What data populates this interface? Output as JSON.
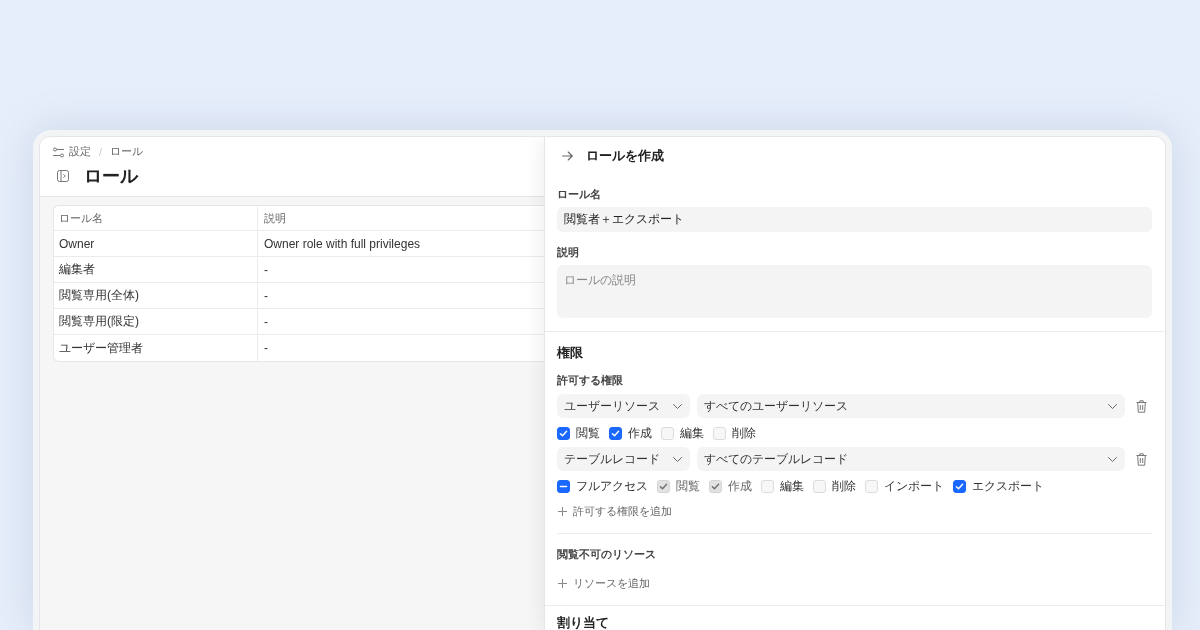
{
  "breadcrumb": {
    "items": [
      "設定",
      "ロール"
    ],
    "separator": "/"
  },
  "page_title": "ロール",
  "table": {
    "columns": [
      "ロール名",
      "説明"
    ],
    "rows": [
      [
        "Owner",
        "Owner role with full privileges"
      ],
      [
        "編集者",
        "-"
      ],
      [
        "閲覧専用(全体)",
        "-"
      ],
      [
        "閲覧専用(限定)",
        "-"
      ],
      [
        "ユーザー管理者",
        "-"
      ]
    ]
  },
  "drawer": {
    "title": "ロールを作成",
    "name_field": {
      "label": "ロール名",
      "value": "閲覧者＋エクスポート"
    },
    "description_field": {
      "label": "説明",
      "placeholder": "ロールの説明"
    },
    "permissions": {
      "title": "権限",
      "allowed": {
        "label": "許可する権限",
        "rules": [
          {
            "resource": "ユーザーリソース",
            "scope": "すべてのユーザーリソース",
            "actions": [
              {
                "label": "閲覧",
                "checked": true,
                "indeterminate": false,
                "disabled": false
              },
              {
                "label": "作成",
                "checked": true,
                "indeterminate": false,
                "disabled": false
              },
              {
                "label": "編集",
                "checked": false,
                "indeterminate": false,
                "disabled": false
              },
              {
                "label": "削除",
                "checked": false,
                "indeterminate": false,
                "disabled": false
              }
            ]
          },
          {
            "resource": "テーブルレコード",
            "scope": "すべてのテーブルレコード",
            "actions": [
              {
                "label": "フルアクセス",
                "checked": true,
                "indeterminate": true,
                "disabled": false
              },
              {
                "label": "閲覧",
                "checked": true,
                "indeterminate": false,
                "disabled": true
              },
              {
                "label": "作成",
                "checked": true,
                "indeterminate": false,
                "disabled": true
              },
              {
                "label": "編集",
                "checked": false,
                "indeterminate": false,
                "disabled": false
              },
              {
                "label": "削除",
                "checked": false,
                "indeterminate": false,
                "disabled": false
              },
              {
                "label": "インポート",
                "checked": false,
                "indeterminate": false,
                "disabled": false
              },
              {
                "label": "エクスポート",
                "checked": true,
                "indeterminate": false,
                "disabled": false
              }
            ]
          }
        ],
        "add_label": "許可する権限を追加"
      },
      "denied": {
        "label": "閲覧不可のリソース",
        "add_label": "リソースを追加"
      }
    },
    "assignment": {
      "title": "割り当て"
    }
  }
}
